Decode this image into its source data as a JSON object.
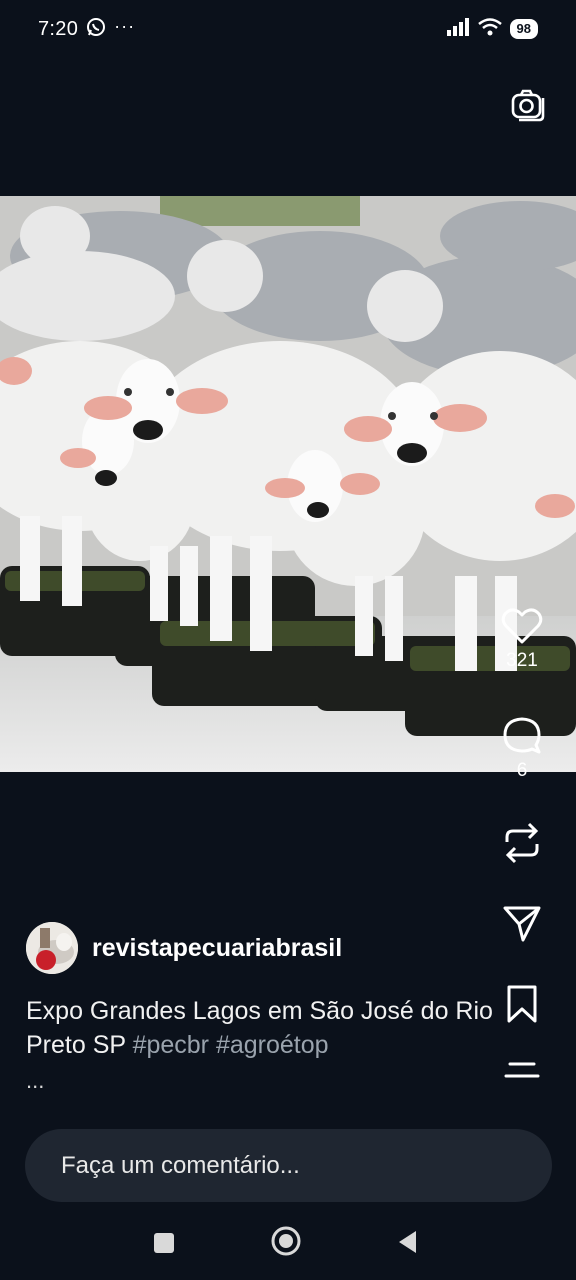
{
  "status_bar": {
    "time": "7:20",
    "battery": "98",
    "more": "···"
  },
  "post": {
    "username": "revistapecuariabrasil",
    "caption_text": "Expo Grandes Lagos em São José do Rio Preto SP",
    "hashtags": "#pecbr #agroétop",
    "caption_more": "...",
    "likes": "321",
    "comments": "6"
  },
  "comment_box": {
    "placeholder": "Faça um comentário..."
  },
  "icons": {
    "status": [
      "whatsapp-icon",
      "signal-icon",
      "wifi-icon"
    ],
    "actions": [
      "camera-icon",
      "heart-icon",
      "comment-icon",
      "repost-icon",
      "share-icon",
      "bookmark-icon",
      "menu-icon"
    ],
    "nav": [
      "recents-icon",
      "home-icon",
      "back-icon"
    ]
  },
  "colors": {
    "background": "#0b111b",
    "input_background": "#1f2631",
    "hashtag": "#9aa3ad",
    "text": "#ffffff"
  }
}
